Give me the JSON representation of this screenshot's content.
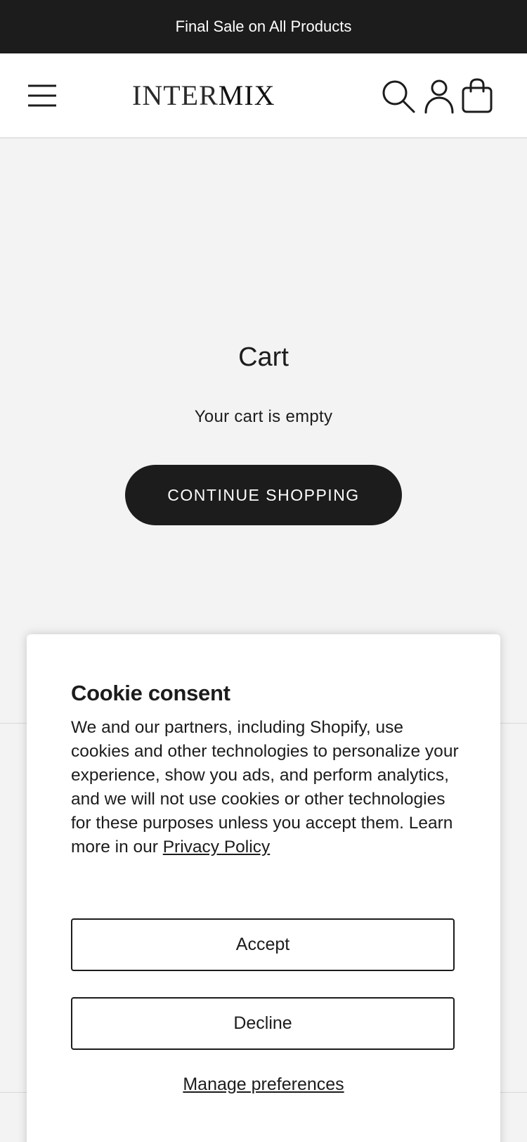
{
  "announcement": {
    "text": "Final Sale on All Products"
  },
  "header": {
    "logo_part_thin": "INTER",
    "logo_part_bold": "MIX",
    "icons": {
      "menu": "hamburger-menu-icon",
      "search": "search-icon",
      "account": "account-icon",
      "cart": "shopping-bag-icon"
    }
  },
  "cart": {
    "title": "Cart",
    "empty_message": "Your cart is empty",
    "continue_label": "CONTINUE SHOPPING"
  },
  "cookie_consent": {
    "title": "Cookie consent",
    "body": "We and our partners, including Shopify, use cookies and other technologies to personalize your experience, show you ads, and perform analytics, and we will not use cookies or other technologies for these purposes unless you accept them. Learn more in our ",
    "privacy_link": "Privacy Policy",
    "accept_label": "Accept",
    "decline_label": "Decline",
    "manage_label": "Manage preferences"
  },
  "colors": {
    "dark": "#1c1c1c",
    "background": "#f3f3f3",
    "surface": "#ffffff"
  }
}
